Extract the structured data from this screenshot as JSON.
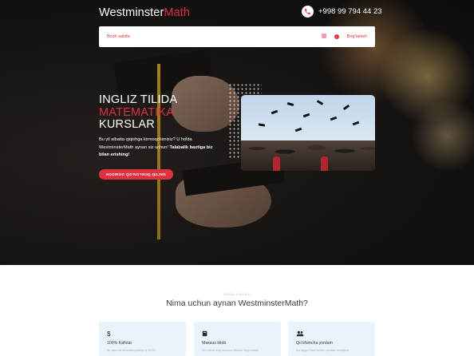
{
  "header": {
    "logo_main": "Westminster",
    "logo_accent": "Math",
    "phone": "+998 99 794 44 23"
  },
  "nav": {
    "home": "Bosh sahifa",
    "menu_icon": "menu-icon",
    "contact": "Bog'lanish"
  },
  "hero": {
    "headline_line1": "INGLIZ TILIDA",
    "headline_line2": "MATEMATIKA",
    "headline_line3": "KURSLAR",
    "lead_text": "Bu yil albatta qiqishga kirmoqchimisiz? U holda WestminsterMath aynan siz uchun!",
    "lead_bold": "Talabalik baxtiga biz bilan erishing!",
    "cta_label": "HOZIRGO QO'NG'IROQ QILING"
  },
  "section": {
    "eyebrow": "AFZALLIKLAR",
    "title": "Nima uchun aynan WestminsterMath?"
  },
  "cards": [
    {
      "icon": "dollar-icon",
      "title": "100% Kafolat",
      "subtitle": "Bu qancha muvaffaqiyatsiyo'q 100%"
    },
    {
      "icon": "book-icon",
      "title": "Maxsus kitob",
      "subtitle": "Siz uchun eng maxsus kitoblar tayyorladik"
    },
    {
      "icon": "users-icon",
      "title": "Qo'shimcha yordam",
      "subtitle": "Siz qiyga hojat bo'lsin yordam berilgina"
    }
  ],
  "colors": {
    "accent": "#e0313f",
    "card_bg": "#e8f3fc"
  }
}
